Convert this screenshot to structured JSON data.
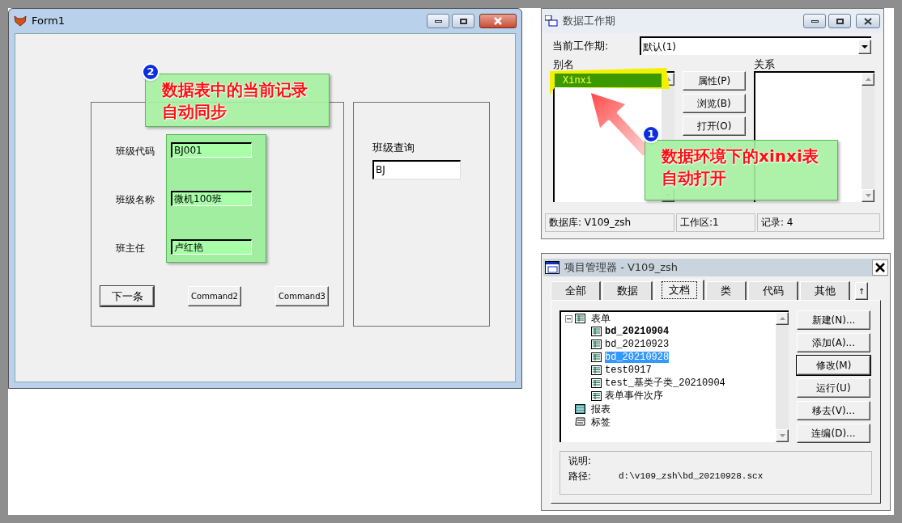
{
  "form1": {
    "title": "Form1",
    "fields": [
      {
        "label": "班级代码",
        "value": "BJ001"
      },
      {
        "label": "班级名称",
        "value": "微机100班"
      },
      {
        "label": "班主任",
        "value": "卢红艳"
      }
    ],
    "buttons": [
      "下一条",
      "Command2",
      "Command3"
    ],
    "query": {
      "label": "班级查询",
      "value": "BJ"
    }
  },
  "callouts": [
    {
      "number": "2",
      "lines": [
        "数据表中的当前记录",
        "自动同步"
      ]
    },
    {
      "number": "1",
      "lines": [
        "数据环境下的xinxi表",
        "自动打开"
      ]
    }
  ],
  "data_session": {
    "title": "数据工作期",
    "session_label": "当前工作期:",
    "session_value": "默认(1)",
    "alias_label": "别名",
    "aliases": [
      {
        "name": "Xinxi",
        "selected": true
      }
    ],
    "buttons": [
      "属性(P)",
      "浏览(B)",
      "打开(O)"
    ],
    "relations_label": "关系",
    "status": [
      "数据库: V109_zsh",
      "工作区:1",
      "记录: 4"
    ]
  },
  "project_manager": {
    "title": "项目管理器 - V109_zsh",
    "tabs": [
      {
        "label": "全部",
        "selected": false
      },
      {
        "label": "数据",
        "selected": false
      },
      {
        "label": "文档",
        "selected": true
      },
      {
        "label": "类",
        "selected": false
      },
      {
        "label": "代码",
        "selected": false
      },
      {
        "label": "其他",
        "selected": false
      }
    ],
    "collapse_button": "↑",
    "tree": [
      {
        "label": "表单",
        "kind": "form",
        "expanded": true,
        "children": [
          {
            "label": "bd_20210904",
            "bold": true,
            "selected": false
          },
          {
            "label": "bd_20210923",
            "bold": false,
            "selected": false
          },
          {
            "label": "bd_20210928",
            "bold": false,
            "selected": true
          },
          {
            "label": "test0917",
            "bold": false,
            "selected": false
          },
          {
            "label": "test_基类子类_20210904",
            "bold": false,
            "selected": false
          },
          {
            "label": "表单事件次序",
            "bold": false,
            "selected": false
          }
        ]
      },
      {
        "label": "报表",
        "kind": "report"
      },
      {
        "label": "标签",
        "kind": "label"
      }
    ],
    "buttons": [
      {
        "label": "新建(N)...",
        "default": false
      },
      {
        "label": "添加(A)...",
        "default": false
      },
      {
        "label": "修改(M)",
        "default": true
      },
      {
        "label": "运行(U)",
        "default": false
      },
      {
        "label": "移去(V)...",
        "default": false
      },
      {
        "label": "连编(D)...",
        "default": false
      }
    ],
    "description_label": "说明:",
    "path_label": "路径:",
    "path": "d:\\v109_zsh\\bd_20210928.scx"
  }
}
